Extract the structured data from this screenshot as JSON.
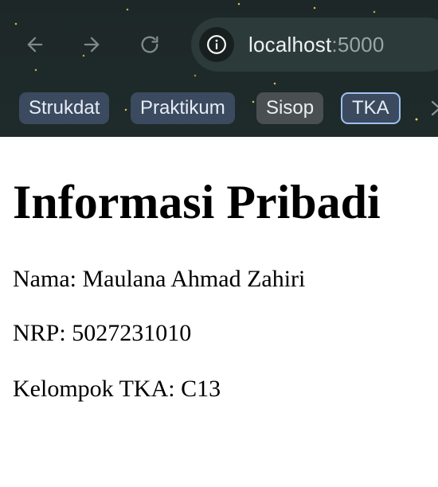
{
  "browser": {
    "url_host": "localhost",
    "url_port": ":5000",
    "bookmarks": [
      {
        "label": "Strukdat"
      },
      {
        "label": "Praktikum"
      },
      {
        "label": "Sisop"
      },
      {
        "label": "TKA"
      }
    ]
  },
  "page": {
    "title": "Informasi Pribadi",
    "lines": {
      "nama": "Nama: Maulana Ahmad Zahiri",
      "nrp": "NRP: 5027231010",
      "kelompok": "Kelompok TKA: C13"
    }
  },
  "colors": {
    "chrome_background": "#1f2a2a",
    "omnibox_background": "#2c3a3a",
    "bookmark_chip": "#3b4a5f",
    "bookmark_selected_border": "#9ec0f0"
  },
  "icons": {
    "back": "arrow-left-icon",
    "forward": "arrow-right-icon",
    "reload": "reload-icon",
    "site_info": "info-icon",
    "more": "chevron-right-icon"
  }
}
